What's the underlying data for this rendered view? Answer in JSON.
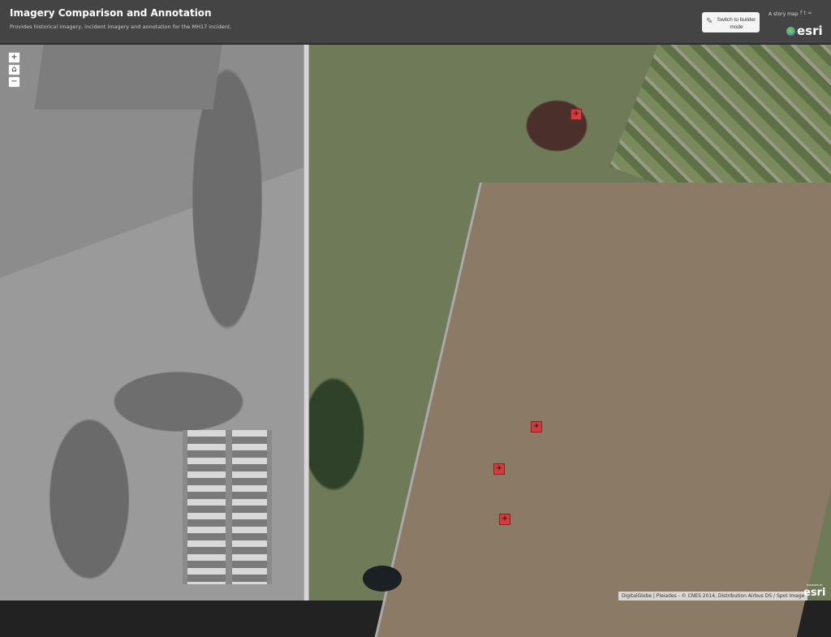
{
  "header": {
    "title": "Imagery Comparison and Annotation",
    "subtitle": "Provides historical imagery, incident imagery and annotation for the MH17 incident.",
    "builder_button": "Switch to builder mode",
    "story_map_label": "A story map",
    "social": [
      "facebook-icon",
      "twitter-icon",
      "link-icon"
    ],
    "logo": "esri"
  },
  "map": {
    "zoom_in": "+",
    "home": "⌂",
    "zoom_out": "−",
    "markers": [
      "crash-site-marker",
      "debris-marker",
      "debris-marker",
      "debris-marker"
    ],
    "attribution": "DigitalGlobe | Pleiades - © CNES 2014, Distribution Airbus DS / Spot Image",
    "powered_by": "POWERED BY",
    "powered_logo": "esri",
    "marker_color": "#d83a3a"
  }
}
